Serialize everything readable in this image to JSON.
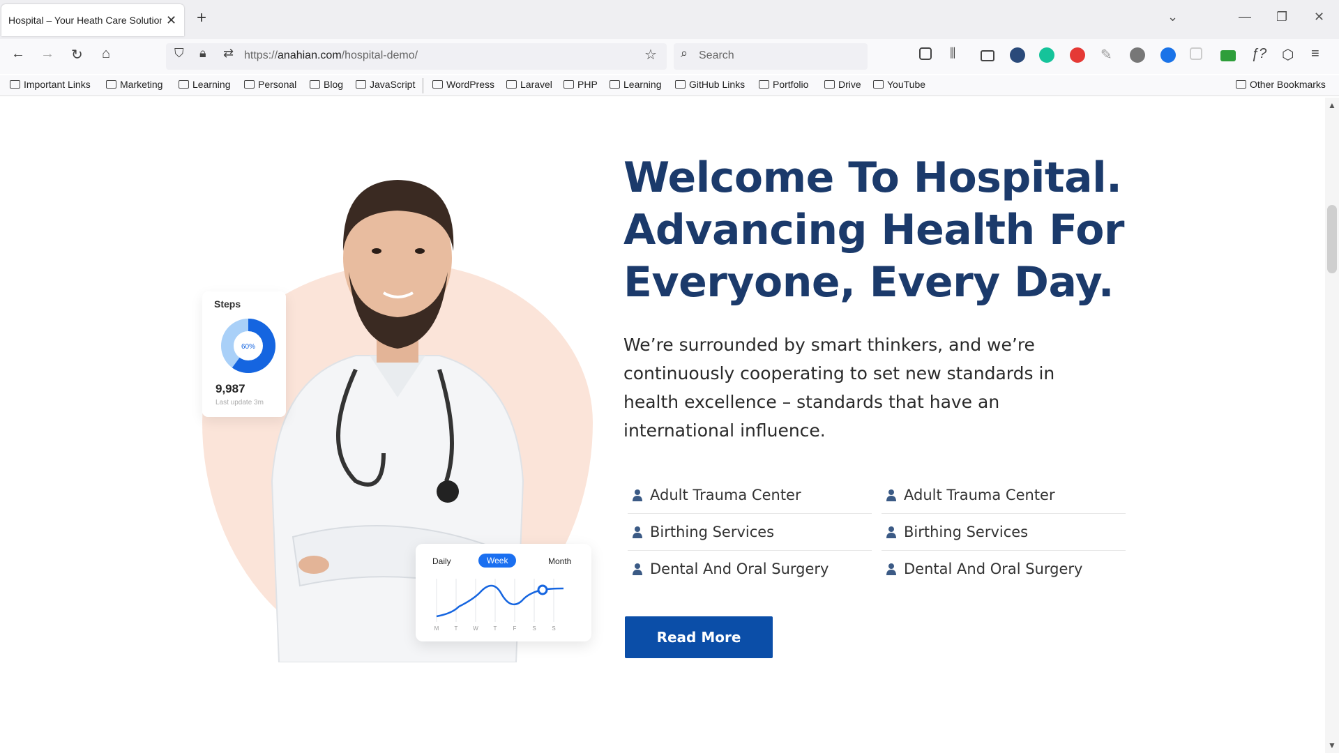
{
  "browser": {
    "tab_title": "Hospital – Your Heath Care Solution",
    "tab_close": "✕",
    "new_tab": "+",
    "url_prefix": "https://",
    "url_domain": "anahian.com",
    "url_path": "/hospital-demo/",
    "search_placeholder": "Search",
    "bookmarks": [
      "Important Links",
      "Marketing",
      "Learning",
      "Personal",
      "Blog",
      "JavaScript",
      "WordPress",
      "Laravel",
      "PHP",
      "Learning",
      "GitHub Links",
      "Portfolio",
      "Drive",
      "YouTube"
    ],
    "other_bookmarks": "Other Bookmarks"
  },
  "hero": {
    "headline_line1": "Welcome To Hospital.",
    "headline_line2": "Advancing Health For",
    "headline_line3": "Everyone, Every Day.",
    "lead": "We’re surrounded by smart thinkers, and we’re continuously cooperating to set new standards in health excellence – standards that have an international influence.",
    "features_left": [
      "Adult Trauma Center",
      "Birthing Services",
      "Dental And Oral Surgery"
    ],
    "features_right": [
      "Adult Trauma Center",
      "Birthing Services",
      "Dental And Oral Surgery"
    ],
    "cta_label": "Read More"
  },
  "steps_widget": {
    "title": "Steps",
    "percent_label": "60%",
    "percent": 0.6,
    "value": "9,987",
    "subtitle": "Last update 3m"
  },
  "activity_widget": {
    "tabs": [
      "Daily",
      "Week",
      "Month"
    ],
    "active_tab": "Week",
    "day_labels": [
      "M",
      "T",
      "W",
      "T",
      "F",
      "S",
      "S"
    ]
  },
  "colors": {
    "headline": "#1b3a6b",
    "accent": "#0b4ea8",
    "blob": "#fbe4d9"
  }
}
